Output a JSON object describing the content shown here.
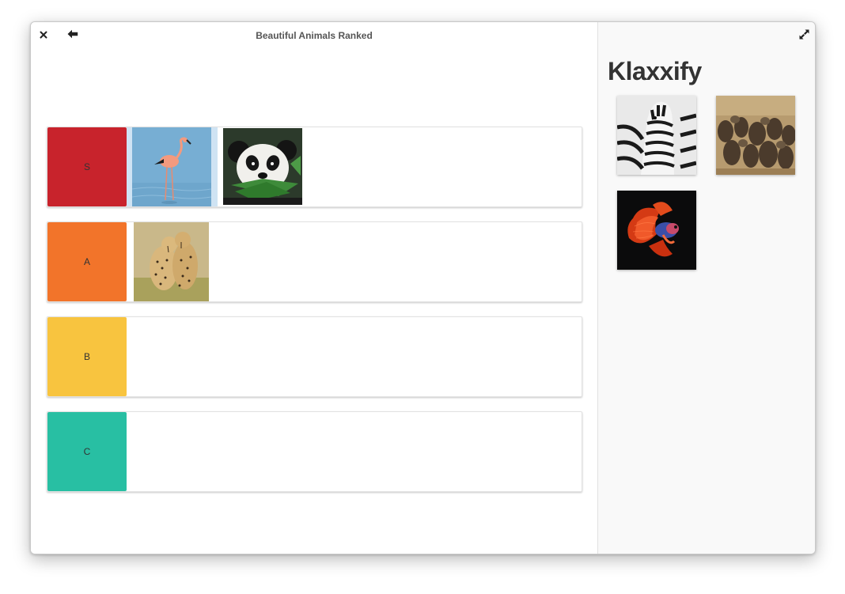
{
  "window": {
    "title": "Beautiful Animals Ranked"
  },
  "toolbar": {
    "close_icon": "close-icon",
    "back_icon": "arrow-left-icon",
    "expand_icon": "expand-icon"
  },
  "tiers": [
    {
      "label": "S",
      "color": "#c8232c",
      "items": [
        "flamingo",
        "panda"
      ]
    },
    {
      "label": "A",
      "color": "#f2742a",
      "items": [
        "cheetahs"
      ]
    },
    {
      "label": "B",
      "color": "#f8c43f",
      "items": []
    },
    {
      "label": "C",
      "color": "#28bfa3",
      "items": []
    }
  ],
  "sidebar": {
    "app_name": "Klaxxify",
    "pool_items": [
      "zebra",
      "wildebeest",
      "betta-fish"
    ]
  }
}
